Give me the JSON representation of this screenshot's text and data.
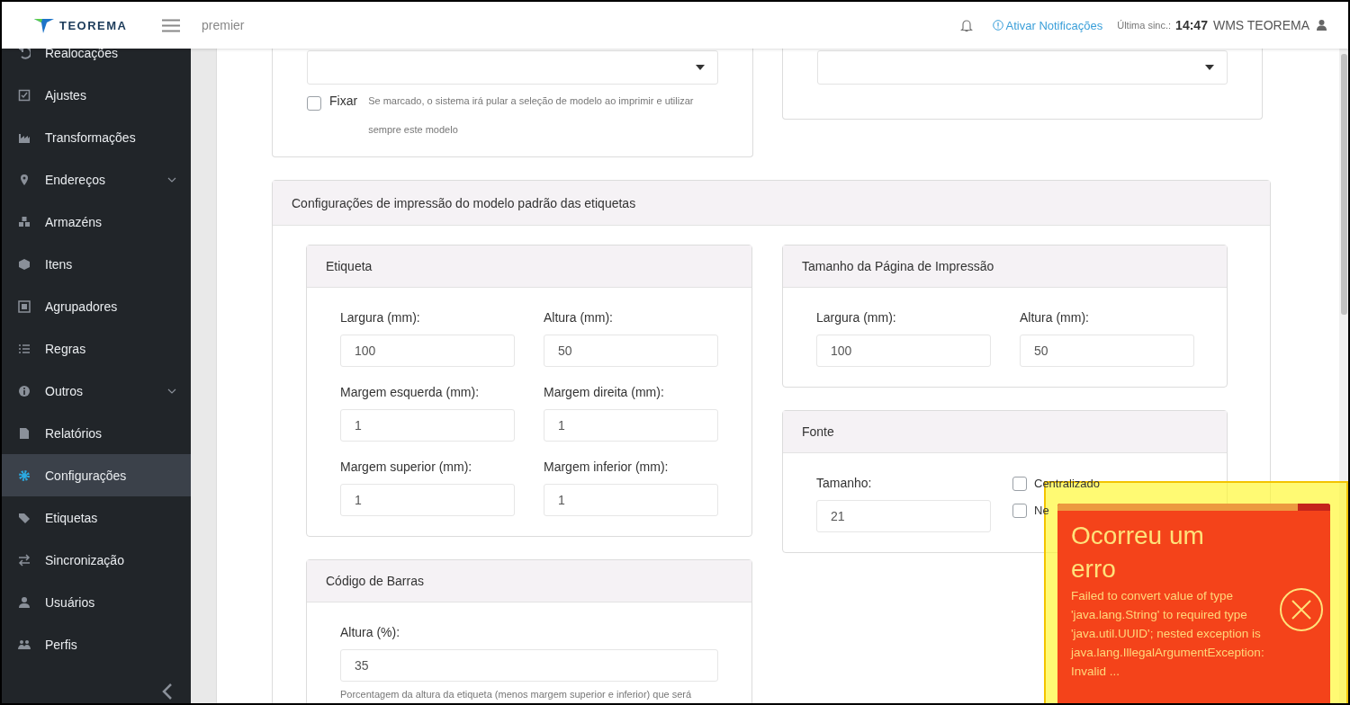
{
  "header": {
    "brand": "TEOREMA",
    "workspace": "premier",
    "notify_link": "Ativar Notificações",
    "sync_label": "Última sinc.:",
    "sync_time": "14:47",
    "user": "WMS TEOREMA"
  },
  "sidebar": {
    "items": [
      {
        "label": "Realocações",
        "selected": false,
        "has_submenu": false
      },
      {
        "label": "Ajustes",
        "selected": false,
        "has_submenu": false
      },
      {
        "label": "Transformações",
        "selected": false,
        "has_submenu": false
      },
      {
        "label": "Endereços",
        "selected": false,
        "has_submenu": true
      },
      {
        "label": "Armazéns",
        "selected": false,
        "has_submenu": false
      },
      {
        "label": "Itens",
        "selected": false,
        "has_submenu": false
      },
      {
        "label": "Agrupadores",
        "selected": false,
        "has_submenu": false
      },
      {
        "label": "Regras",
        "selected": false,
        "has_submenu": false
      },
      {
        "label": "Outros",
        "selected": false,
        "has_submenu": true
      },
      {
        "label": "Relatórios",
        "selected": false,
        "has_submenu": false
      },
      {
        "label": "Configurações",
        "selected": true,
        "has_submenu": false
      },
      {
        "label": "Etiquetas",
        "selected": false,
        "has_submenu": false
      },
      {
        "label": "Sincronização",
        "selected": false,
        "has_submenu": false
      },
      {
        "label": "Usuários",
        "selected": false,
        "has_submenu": false
      },
      {
        "label": "Perfis",
        "selected": false,
        "has_submenu": false
      }
    ]
  },
  "top_cards": [
    {
      "kind": "select_with_fix",
      "checkbox": {
        "label": "Fixar",
        "checked": false
      },
      "help": "Se marcado, o sistema irá pular a seleção de modelo ao imprimir e utilizar sempre este modelo"
    },
    {
      "kind": "select"
    }
  ],
  "print_settings": {
    "title": "Configurações de impressão do modelo padrão das etiquetas",
    "left_cards": [
      {
        "title": "Etiqueta",
        "fields": [
          {
            "label": "Largura (mm):",
            "value": "100"
          },
          {
            "label": "Altura (mm):",
            "value": "50"
          },
          {
            "label": "Margem esquerda (mm):",
            "value": "1"
          },
          {
            "label": "Margem direita (mm):",
            "value": "1"
          },
          {
            "label": "Margem superior (mm):",
            "value": "1"
          },
          {
            "label": "Margem inferior (mm):",
            "value": "1"
          }
        ]
      },
      {
        "title": "Código de Barras",
        "fields": [
          {
            "label": "Altura (%):",
            "value": "35"
          }
        ],
        "help": "Porcentagem da altura da etiqueta (menos margem superior e inferior) que será"
      }
    ],
    "right_cards": [
      {
        "title": "Tamanho da Página de Impressão",
        "fields": [
          {
            "label": "Largura (mm):",
            "value": "100"
          },
          {
            "label": "Altura (mm):",
            "value": "50"
          }
        ]
      },
      {
        "title": "Fonte",
        "fields": [
          {
            "label": "Tamanho:",
            "value": "21"
          }
        ],
        "checkboxes": [
          {
            "label": "Centralizado",
            "checked": false
          },
          {
            "label": "Ne",
            "checked": false
          }
        ]
      }
    ]
  },
  "toast": {
    "title": "Ocorreu um erro",
    "message": "Failed to convert value of type 'java.lang.String' to required type 'java.util.UUID'; nested exception is java.lang.IllegalArgumentException: Invalid ...",
    "level": 0.88
  }
}
